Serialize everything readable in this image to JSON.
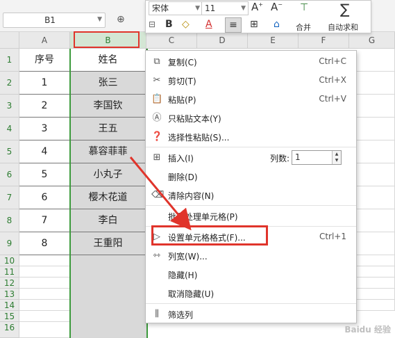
{
  "namebox": {
    "value": "B1"
  },
  "columns": [
    "A",
    "B",
    "C",
    "D",
    "E",
    "F",
    "G"
  ],
  "rows": [
    "1",
    "2",
    "3",
    "4",
    "5",
    "6",
    "7",
    "8",
    "9",
    "10",
    "11",
    "12",
    "13",
    "14",
    "15",
    "16"
  ],
  "table": {
    "header": [
      "序号",
      "姓名"
    ],
    "data": [
      [
        "1",
        "张三"
      ],
      [
        "2",
        "李国钦"
      ],
      [
        "3",
        "王五"
      ],
      [
        "4",
        "慕容菲菲"
      ],
      [
        "5",
        "小丸子"
      ],
      [
        "6",
        "樱木花道"
      ],
      [
        "7",
        "李白"
      ],
      [
        "8",
        "王重阳"
      ]
    ]
  },
  "ribbon": {
    "font_name": "宋体",
    "font_size": "11",
    "merge_label": "合并",
    "autosum_label": "自动求和"
  },
  "menu": {
    "items": {
      "copy": {
        "label": "复制(C)",
        "shortcut": "Ctrl+C"
      },
      "cut": {
        "label": "剪切(T)",
        "shortcut": "Ctrl+X"
      },
      "paste": {
        "label": "粘贴(P)",
        "shortcut": "Ctrl+V"
      },
      "paste_text": {
        "label": "只粘贴文本(Y)"
      },
      "paste_special": {
        "label": "选择性粘贴(S)..."
      },
      "insert": {
        "label": "插入(I)",
        "count_label": "列数:",
        "count_value": "1"
      },
      "delete": {
        "label": "删除(D)"
      },
      "clear": {
        "label": "清除内容(N)"
      },
      "batch": {
        "label": "批量处理单元格(P)"
      },
      "format": {
        "label": "设置单元格格式(F)...",
        "shortcut": "Ctrl+1"
      },
      "width": {
        "label": "列宽(W)..."
      },
      "hide": {
        "label": "隐藏(H)"
      },
      "unhide": {
        "label": "取消隐藏(U)"
      },
      "filter": {
        "label": "筛选列"
      }
    }
  },
  "colors": {
    "accent_green": "#3c9a3c",
    "highlight_red": "#e0342b",
    "selection_gray": "#d9d9d9"
  },
  "watermark": "Baidu 经验"
}
